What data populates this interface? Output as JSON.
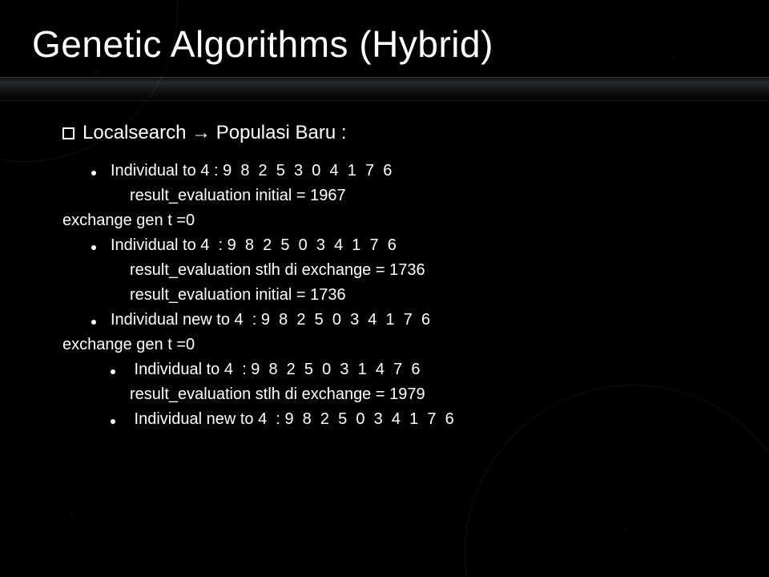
{
  "title": "Genetic Algorithms (Hybrid)",
  "heading": "Localsearch → Populasi Baru :",
  "lines": [
    {
      "bullet": true,
      "indent": 0,
      "text": "Individual to 4 : 9  8  2  5  3  0  4  1  7  6"
    },
    {
      "bullet": false,
      "indent": 1,
      "text": "result_evaluation initial = 1967"
    },
    {
      "bullet": false,
      "indent": -1,
      "text": "exchange gen t =0"
    },
    {
      "bullet": true,
      "indent": 0,
      "text": "Individual to 4  : 9  8  2  5  0  3  4  1  7  6"
    },
    {
      "bullet": false,
      "indent": 1,
      "text": "result_evaluation stlh di exchange = 1736"
    },
    {
      "bullet": false,
      "indent": 1,
      "text": "result_evaluation initial = 1736"
    },
    {
      "bullet": true,
      "indent": 0,
      "text": "Individual new to 4  : 9  8  2  5  0  3  4  1  7  6"
    },
    {
      "bullet": false,
      "indent": -1,
      "text": "exchange gen t =0"
    },
    {
      "bullet": true,
      "indent": 1,
      "text": " Individual to 4  : 9  8  2  5  0  3  1  4  7  6"
    },
    {
      "bullet": false,
      "indent": 1,
      "text": "result_evaluation stlh di exchange = 1979"
    },
    {
      "bullet": true,
      "indent": 1,
      "text": " Individual new to 4  : 9  8  2  5  0  3  4  1  7  6"
    }
  ]
}
